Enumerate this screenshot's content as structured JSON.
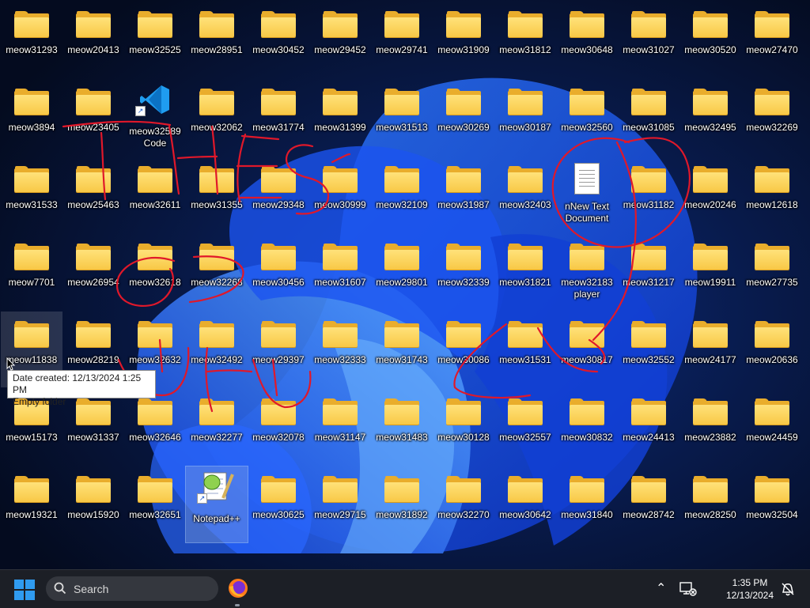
{
  "desktop": {
    "rows": [
      [
        "meow31293",
        "meow20413",
        "meow32525",
        "meow28951",
        "meow30452",
        "meow29452",
        "meow29741",
        "meow31909",
        "meow31812",
        "meow30648",
        "meow31027",
        "meow30520",
        "meow27470"
      ],
      [
        "meow3894",
        "meow23405",
        "meow32589",
        "meow32062",
        "meow31774",
        "meow31399",
        "meow31513",
        "meow30269",
        "meow30187",
        "meow32560",
        "meow31085",
        "meow32495",
        "meow32269"
      ],
      [
        "meow31533",
        "meow25463",
        "meow32611",
        "meow31355",
        "meow29348",
        "meow30999",
        "meow32109",
        "meow31987",
        "meow32403",
        "nNew Text\nDocument",
        "meow31182",
        "meow20246",
        "meow12618"
      ],
      [
        "meow7701",
        "meow26954",
        "meow32618",
        "meow32268",
        "meow30456",
        "meow31607",
        "meow29801",
        "meow32339",
        "meow31821",
        "meow32183\nplayer",
        "meow31217",
        "meow19911",
        "meow27735"
      ],
      [
        "meow11838",
        "meow28219",
        "meow32632",
        "meow32492",
        "meow29397",
        "meow32333",
        "meow31743",
        "meow30086",
        "meow31531",
        "meow30817",
        "meow32552",
        "meow24177",
        "meow20636"
      ],
      [
        "meow15173",
        "meow31337",
        "meow32646",
        "meow32277",
        "meow32078",
        "meow31147",
        "meow31483",
        "meow30128",
        "meow32557",
        "meow30832",
        "meow24413",
        "meow23882",
        "meow24459"
      ],
      [
        "meow19321",
        "meow15920",
        "meow32651",
        "Notepad++",
        "meow30625",
        "meow29715",
        "meow31892",
        "meow32270",
        "meow30642",
        "meow31840",
        "meow28742",
        "meow28250",
        "meow32504"
      ]
    ],
    "extra_labels": {
      "vscode_caption": "Code"
    },
    "tooltip": {
      "line1": "Date created: 12/13/2024 1:25 PM",
      "line2": "Empty folder"
    },
    "scribble_color": "#e0182a",
    "folder_color": "#f8c846"
  },
  "taskbar": {
    "search_label": "Search",
    "clock_time": "1:35 PM",
    "clock_date": "12/13/2024",
    "icons": [
      "windows-start-icon",
      "search-icon",
      "firefox-icon",
      "chevron-up-icon",
      "network-icon",
      "notification-bell-icon"
    ]
  }
}
